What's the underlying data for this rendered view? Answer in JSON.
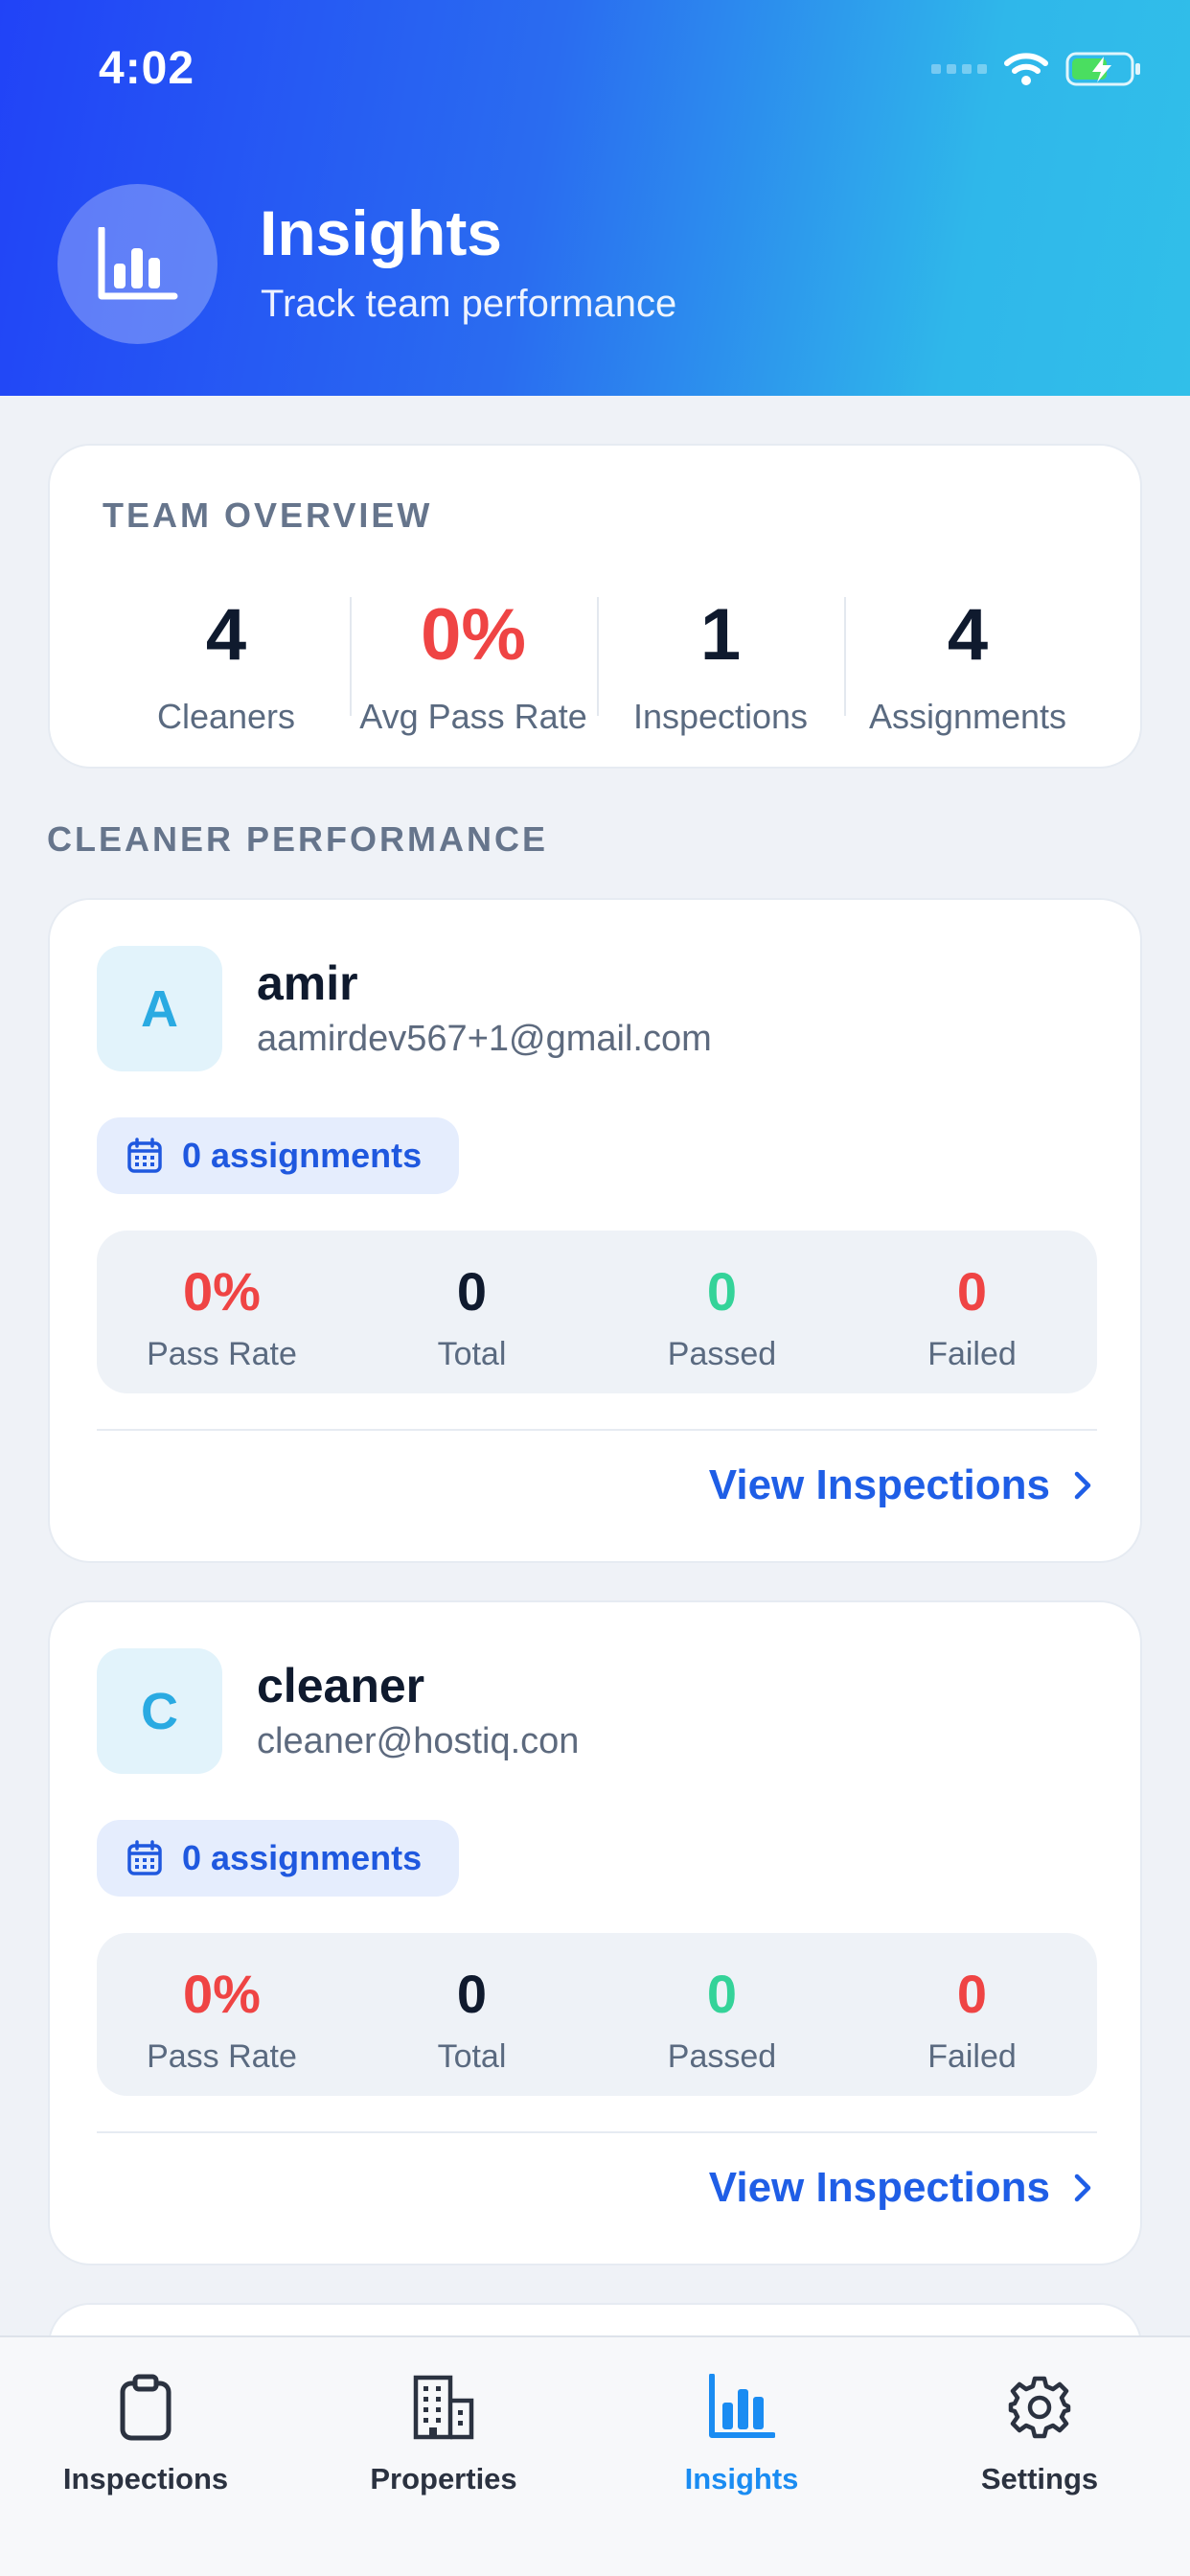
{
  "status_bar": {
    "time": "4:02"
  },
  "header": {
    "title": "Insights",
    "subtitle": "Track team performance",
    "icon": "bar-chart-icon"
  },
  "overview": {
    "label": "TEAM OVERVIEW",
    "stats": [
      {
        "value": "4",
        "label": "Cleaners"
      },
      {
        "value": "0%",
        "label": "Avg Pass Rate"
      },
      {
        "value": "1",
        "label": "Inspections"
      },
      {
        "value": "4",
        "label": "Assignments"
      }
    ]
  },
  "performance": {
    "label": "CLEANER PERFORMANCE",
    "cleaners": [
      {
        "initial": "A",
        "name": "amir",
        "email": "aamirdev567+1@gmail.com",
        "assignments": "0 assignments",
        "stats": [
          {
            "value": "0%",
            "label": "Pass Rate"
          },
          {
            "value": "0",
            "label": "Total"
          },
          {
            "value": "0",
            "label": "Passed"
          },
          {
            "value": "0",
            "label": "Failed"
          }
        ],
        "link": "View Inspections"
      },
      {
        "initial": "C",
        "name": "cleaner",
        "email": "cleaner@hostiq.con",
        "assignments": "0 assignments",
        "stats": [
          {
            "value": "0%",
            "label": "Pass Rate"
          },
          {
            "value": "0",
            "label": "Total"
          },
          {
            "value": "0",
            "label": "Passed"
          },
          {
            "value": "0",
            "label": "Failed"
          }
        ],
        "link": "View Inspections"
      }
    ]
  },
  "tabs": [
    {
      "label": "Inspections",
      "icon": "clipboard-icon"
    },
    {
      "label": "Properties",
      "icon": "building-icon"
    },
    {
      "label": "Insights",
      "icon": "bar-chart-icon",
      "active": true
    },
    {
      "label": "Settings",
      "icon": "gear-icon"
    }
  ],
  "colors": {
    "header_start": "#2143f7",
    "header_end": "#31bfe9",
    "accent": "#1f5ee6",
    "active_tab": "#1a8cf2",
    "danger": "#ef4444",
    "success": "#34d399"
  }
}
